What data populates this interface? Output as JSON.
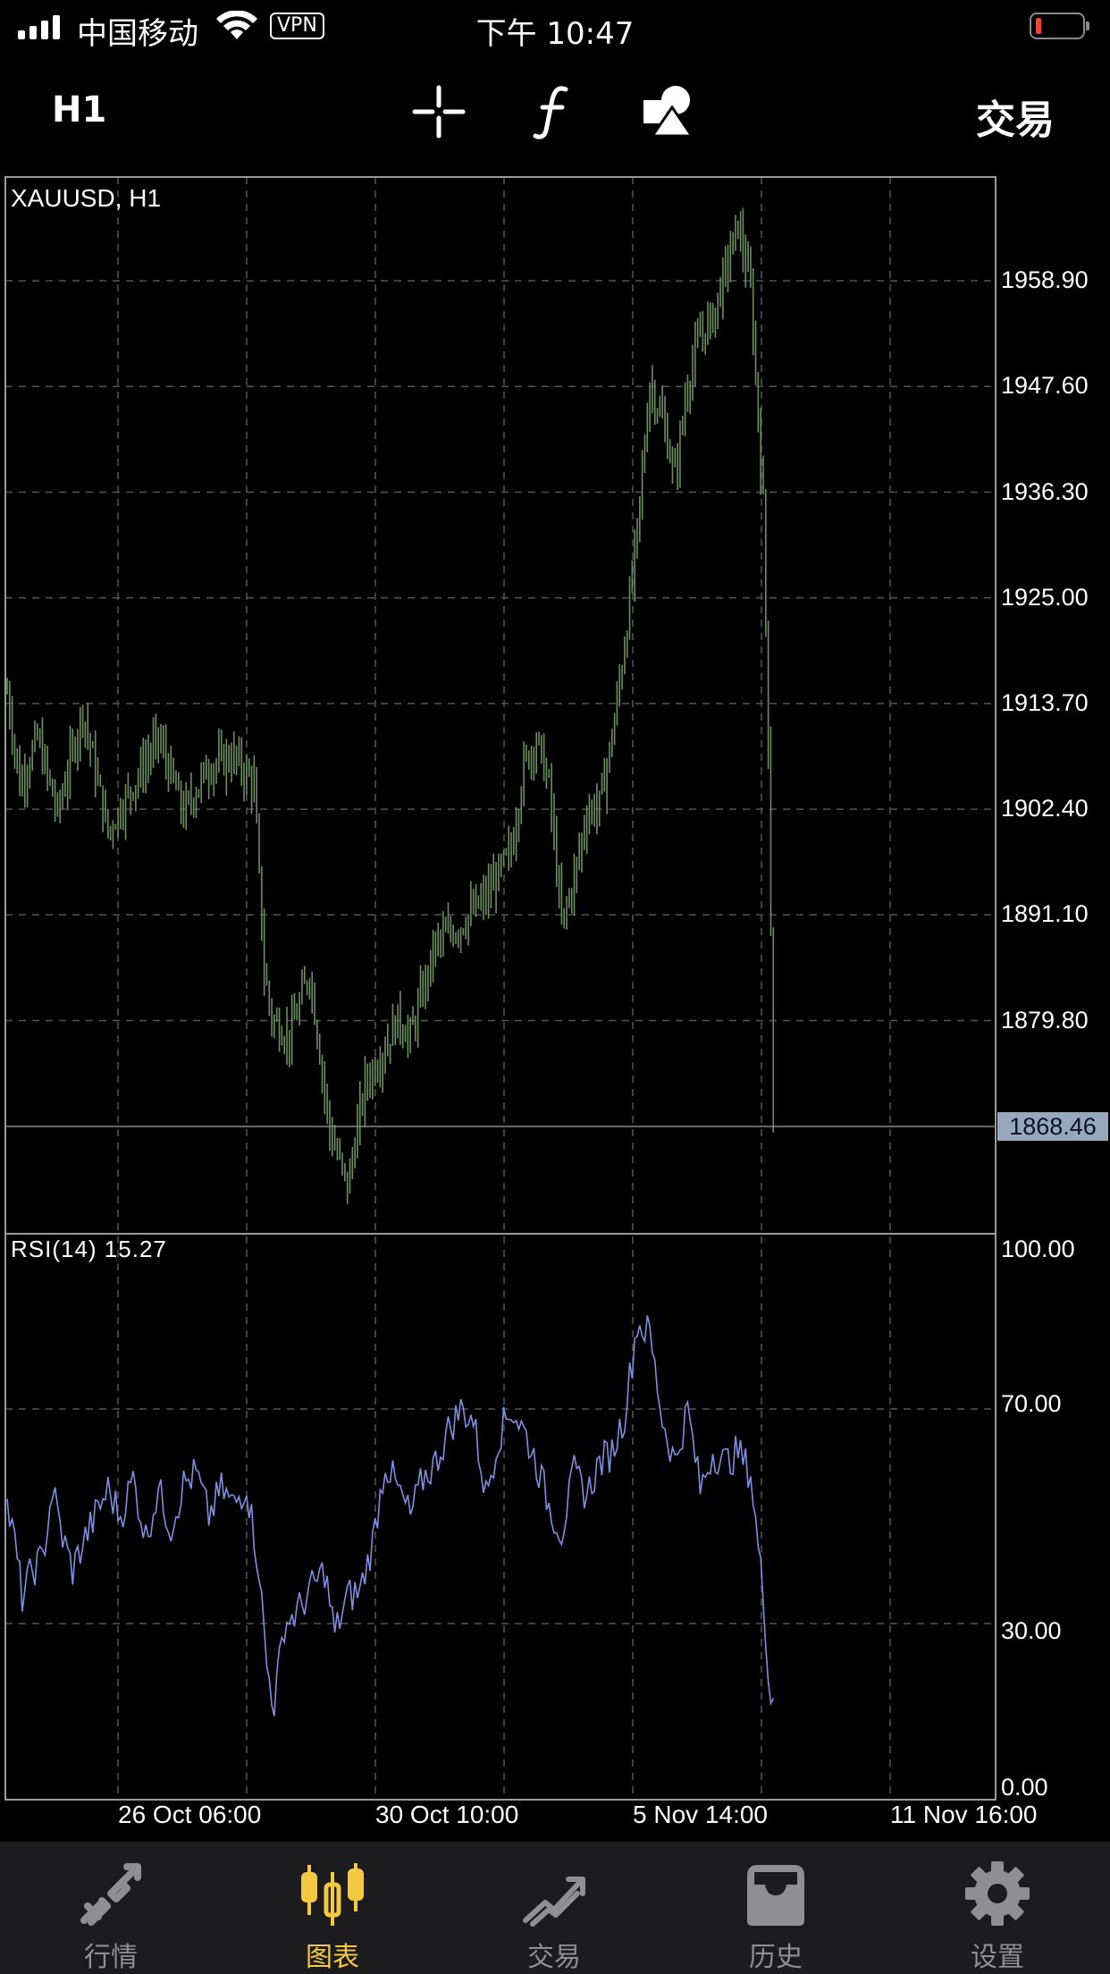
{
  "status_bar": {
    "carrier": "中国移动",
    "vpn": "VPN",
    "time": "下午 10:47"
  },
  "toolbar": {
    "timeframe": "H1",
    "trade_label": "交易",
    "tools": [
      "crosshair-icon",
      "function-icon",
      "objects-icon"
    ]
  },
  "chart": {
    "symbol_label": "XAUUSD, H1",
    "price_ticks": [
      "1958.90",
      "1947.60",
      "1936.30",
      "1925.00",
      "1913.70",
      "1902.40",
      "1891.10",
      "1879.80"
    ],
    "current_price": "1868.46",
    "rsi_label": "RSI(14) 15.27",
    "rsi_ticks": [
      "100.00",
      "70.00",
      "30.00",
      "0.00"
    ],
    "time_ticks": [
      "26 Oct 06:00",
      "30 Oct 10:00",
      "5 Nov 14:00",
      "11 Nov 16:00"
    ],
    "colors": {
      "price_bars": "#6b8f5e",
      "rsi_line": "#7f8fe0",
      "grid": "#555555",
      "background": "#000000"
    }
  },
  "chart_data": {
    "type": "line",
    "price_series": {
      "ylim": [
        1857.0,
        1970.0
      ],
      "anchors": [
        [
          0,
          1915
        ],
        [
          5,
          1905
        ],
        [
          12,
          1910
        ],
        [
          20,
          1902
        ],
        [
          30,
          1913
        ],
        [
          40,
          1900
        ],
        [
          50,
          1905
        ],
        [
          60,
          1910
        ],
        [
          70,
          1902
        ],
        [
          80,
          1907
        ],
        [
          90,
          1908
        ],
        [
          98,
          1905
        ],
        [
          102,
          1885
        ],
        [
          105,
          1880
        ],
        [
          112,
          1878
        ],
        [
          120,
          1885
        ],
        [
          128,
          1868
        ],
        [
          135,
          1862
        ],
        [
          142,
          1873
        ],
        [
          150,
          1877
        ],
        [
          155,
          1880
        ],
        [
          160,
          1878
        ],
        [
          170,
          1888
        ],
        [
          180,
          1890
        ],
        [
          190,
          1893
        ],
        [
          200,
          1898
        ],
        [
          205,
          1907
        ],
        [
          210,
          1910
        ],
        [
          215,
          1905
        ],
        [
          220,
          1890
        ],
        [
          225,
          1895
        ],
        [
          230,
          1902
        ],
        [
          235,
          1903
        ],
        [
          240,
          1910
        ],
        [
          245,
          1920
        ],
        [
          250,
          1932
        ],
        [
          255,
          1948
        ],
        [
          260,
          1944
        ],
        [
          265,
          1938
        ],
        [
          270,
          1948
        ],
        [
          275,
          1953
        ],
        [
          280,
          1955
        ],
        [
          285,
          1960
        ],
        [
          290,
          1965
        ],
        [
          295,
          1958
        ],
        [
          300,
          1935
        ],
        [
          302,
          1910
        ],
        [
          303,
          1890
        ],
        [
          304,
          1868.46
        ]
      ]
    },
    "rsi_series": {
      "ylim": [
        0,
        100
      ],
      "levels": [
        70,
        30
      ],
      "anchors": [
        [
          0,
          52
        ],
        [
          3,
          45
        ],
        [
          6,
          35
        ],
        [
          10,
          40
        ],
        [
          14,
          42
        ],
        [
          18,
          55
        ],
        [
          22,
          46
        ],
        [
          26,
          40
        ],
        [
          30,
          45
        ],
        [
          35,
          50
        ],
        [
          40,
          55
        ],
        [
          45,
          50
        ],
        [
          50,
          57
        ],
        [
          55,
          46
        ],
        [
          60,
          55
        ],
        [
          65,
          48
        ],
        [
          70,
          56
        ],
        [
          75,
          58
        ],
        [
          80,
          50
        ],
        [
          85,
          55
        ],
        [
          90,
          52
        ],
        [
          95,
          56
        ],
        [
          100,
          40
        ],
        [
          103,
          22
        ],
        [
          106,
          15
        ],
        [
          110,
          30
        ],
        [
          115,
          32
        ],
        [
          120,
          36
        ],
        [
          126,
          40
        ],
        [
          130,
          28
        ],
        [
          135,
          35
        ],
        [
          140,
          36
        ],
        [
          145,
          45
        ],
        [
          150,
          60
        ],
        [
          155,
          55
        ],
        [
          160,
          50
        ],
        [
          165,
          57
        ],
        [
          170,
          60
        ],
        [
          175,
          66
        ],
        [
          180,
          70
        ],
        [
          185,
          68
        ],
        [
          190,
          54
        ],
        [
          195,
          65
        ],
        [
          200,
          70
        ],
        [
          205,
          66
        ],
        [
          210,
          60
        ],
        [
          215,
          52
        ],
        [
          220,
          47
        ],
        [
          225,
          58
        ],
        [
          230,
          54
        ],
        [
          235,
          60
        ],
        [
          240,
          62
        ],
        [
          245,
          69
        ],
        [
          250,
          86
        ],
        [
          255,
          84
        ],
        [
          260,
          68
        ],
        [
          265,
          60
        ],
        [
          270,
          70
        ],
        [
          275,
          55
        ],
        [
          280,
          62
        ],
        [
          285,
          60
        ],
        [
          290,
          62
        ],
        [
          295,
          58
        ],
        [
          300,
          35
        ],
        [
          303,
          16
        ]
      ]
    },
    "time_ticks": [
      "26 Oct 06:00",
      "30 Oct 10:00",
      "5 Nov 14:00",
      "11 Nov 16:00"
    ],
    "price_ticks": [
      1958.9,
      1947.6,
      1936.3,
      1925.0,
      1913.7,
      1902.4,
      1891.1,
      1879.8
    ],
    "current_price": 1868.46
  },
  "tab_bar": {
    "tabs": [
      {
        "label": "行情",
        "icon": "quotes-icon",
        "active": false
      },
      {
        "label": "图表",
        "icon": "chart-icon",
        "active": true
      },
      {
        "label": "交易",
        "icon": "trade-icon",
        "active": false
      },
      {
        "label": "历史",
        "icon": "history-icon",
        "active": false
      },
      {
        "label": "设置",
        "icon": "settings-icon",
        "active": false
      }
    ]
  }
}
